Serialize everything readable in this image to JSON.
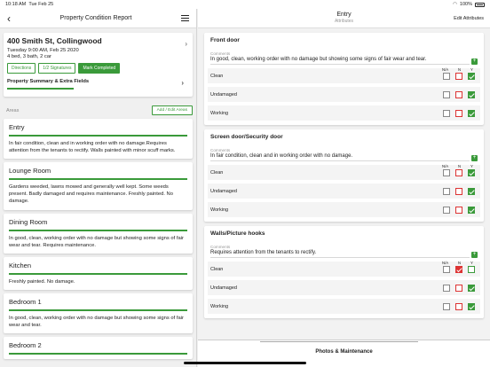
{
  "status": {
    "time": "10:18 AM",
    "date": "Tue Feb 25",
    "battery": "100%"
  },
  "left": {
    "title": "Property Condition Report",
    "address": "400 Smith St, Collingwood",
    "datetime": "Tuesday 9:00 AM, Feb 25 2020",
    "rooms": "4 bed, 3 bath, 2 car",
    "btn_directions": "Directions",
    "btn_signatures": "1/2 Signatures",
    "btn_complete": "Mark Completed",
    "summary": "Property Summary & Extra Fields",
    "areas_label": "Areas",
    "add_areas": "Add / Edit Areas",
    "areas": [
      {
        "name": "Entry",
        "text": "In fair condition, clean and in working order with no damage.Requires attention from the tenants to rectify. Walls painted with minor scuff marks."
      },
      {
        "name": "Lounge Room",
        "text": "Gardens weeded, lawns mowed and generally well kept. Some weeds present. Badly damaged and requires maintenance. Freshly painted. No damage."
      },
      {
        "name": "Dining Room",
        "text": "In good, clean, working order with no damage but showing some signs of fair wear and tear. Requires maintenance."
      },
      {
        "name": "Kitchen",
        "text": "Freshly painted. No damage."
      },
      {
        "name": "Bedroom 1",
        "text": "In good, clean, working order with no damage but showing some signs of fair wear and tear."
      },
      {
        "name": "Bedroom 2",
        "text": ""
      }
    ]
  },
  "right": {
    "title": "Entry",
    "subtitle": "Attributes",
    "edit": "Edit Attributes",
    "comments_label": "Comments",
    "headers": {
      "na": "N/A",
      "n": "N",
      "y": "Y"
    },
    "sections": [
      {
        "title": "Front door",
        "comment": "In good, clean, working order with no damage but showing some signs of fair wear and tear.",
        "rows": [
          {
            "label": "Clean",
            "value": "Y"
          },
          {
            "label": "Undamaged",
            "value": "Y"
          },
          {
            "label": "Working",
            "value": "Y"
          }
        ]
      },
      {
        "title": "Screen door/Security door",
        "comment": "In fair condition, clean and in working order with no damage.",
        "rows": [
          {
            "label": "Clean",
            "value": "Y"
          },
          {
            "label": "Undamaged",
            "value": "Y"
          },
          {
            "label": "Working",
            "value": "Y"
          }
        ]
      },
      {
        "title": "Walls/Picture hooks",
        "comment": "Requires attention from the tenants to rectify.",
        "rows": [
          {
            "label": "Clean",
            "value": "N"
          },
          {
            "label": "Undamaged",
            "value": "Y"
          },
          {
            "label": "Working",
            "value": "Y"
          }
        ]
      }
    ],
    "photos": "Photos & Maintenance"
  },
  "colors": {
    "accent": "#3a9a3a",
    "negative": "#dd3333"
  }
}
